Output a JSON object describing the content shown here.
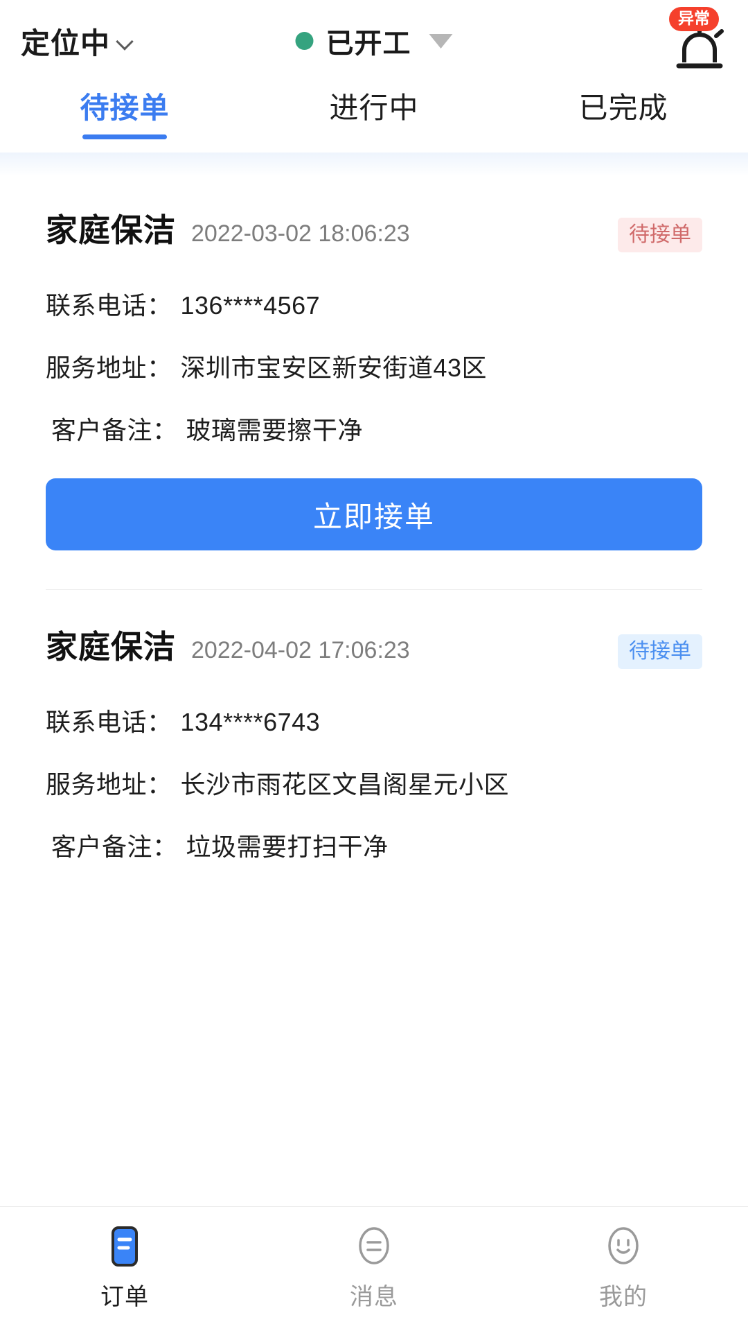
{
  "header": {
    "location_label": "定位中",
    "location_chevron_icon": "chevron-down-icon",
    "work_status": "已开工",
    "work_status_dot_color": "#35a37f",
    "work_status_caret_icon": "caret-down-icon",
    "alarm_badge": "异常",
    "alarm_icon": "siren-alarm-icon",
    "alarm_badge_color": "#f5402c"
  },
  "tabs": {
    "active_index": 0,
    "items": [
      {
        "label": "待接单"
      },
      {
        "label": "进行中"
      },
      {
        "label": "已完成"
      }
    ],
    "active_color": "#3b7cf0"
  },
  "orders": [
    {
      "title": "家庭保洁",
      "time": "2022-03-02 18:06:23",
      "status": "待接单",
      "status_style": "pink",
      "phone_label": "联系电话：",
      "phone_value": "136****4567",
      "address_label": "服务地址：",
      "address_value": "深圳市宝安区新安街道43区",
      "remark_label": "客户备注：",
      "remark_value": "玻璃需要擦干净",
      "action_label": "立即接单",
      "action_color": "#3a84f7"
    },
    {
      "title": "家庭保洁",
      "time": "2022-04-02 17:06:23",
      "status": "待接单",
      "status_style": "blue",
      "phone_label": "联系电话：",
      "phone_value": "134****6743",
      "address_label": "服务地址：",
      "address_value": "长沙市雨花区文昌阁星元小区",
      "remark_label": "客户备注：",
      "remark_value": "垃圾需要打扫干净"
    }
  ],
  "tabbar": {
    "active_index": 0,
    "items": [
      {
        "label": "订单",
        "icon": "order-document-icon"
      },
      {
        "label": "消息",
        "icon": "message-bubble-icon"
      },
      {
        "label": "我的",
        "icon": "smiley-face-icon"
      }
    ],
    "active_color": "#3a84f7"
  }
}
